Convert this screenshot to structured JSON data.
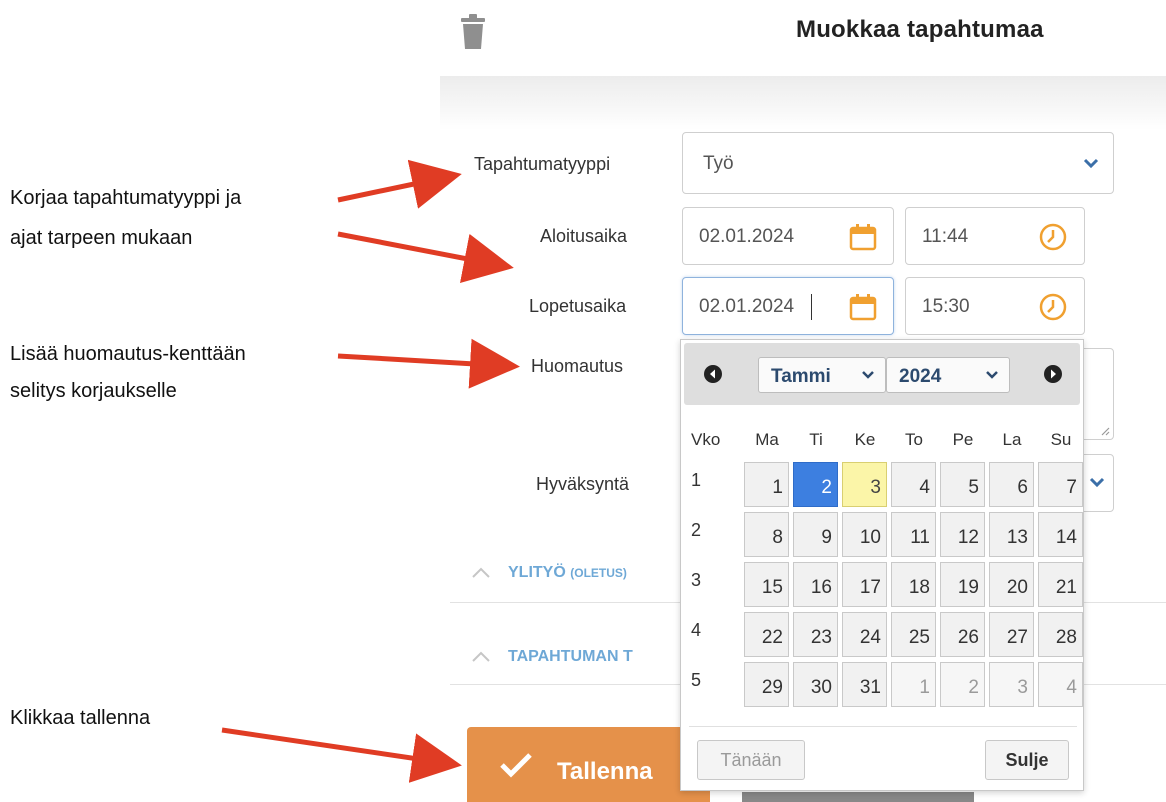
{
  "header": {
    "title": "Muokkaa tapahtumaa"
  },
  "annotations": {
    "event_type_line1": "Korjaa tapahtumatyyppi ja",
    "event_type_line2": "ajat tarpeen mukaan",
    "note_line1": "Lisää huomautus-kenttään",
    "note_line2": "selitys korjaukselle",
    "save": "Klikkaa tallenna"
  },
  "form": {
    "event_type_label": "Tapahtumatyyppi",
    "event_type_value": "Työ",
    "start_label": "Aloitusaika",
    "start_date": "02.01.2024",
    "start_time": "11:44",
    "end_label": "Lopetusaika",
    "end_date": "02.01.2024",
    "end_time": "15:30",
    "note_label": "Huomautus",
    "approval_label": "Hyväksyntä"
  },
  "sections": {
    "overtime": "YLITYÖ",
    "overtime_suffix": "(OLETUS)",
    "event_section": "TAPAHTUMAN T"
  },
  "buttons": {
    "save": "Tallenna"
  },
  "datepicker": {
    "month": "Tammi",
    "year": "2024",
    "week_header": "Vko",
    "weekdays": [
      "Ma",
      "Ti",
      "Ke",
      "To",
      "Pe",
      "La",
      "Su"
    ],
    "weeks": [
      "1",
      "2",
      "3",
      "4",
      "5"
    ],
    "days": [
      [
        "1",
        "2",
        "3",
        "4",
        "5",
        "6",
        "7"
      ],
      [
        "8",
        "9",
        "10",
        "11",
        "12",
        "13",
        "14"
      ],
      [
        "15",
        "16",
        "17",
        "18",
        "19",
        "20",
        "21"
      ],
      [
        "22",
        "23",
        "24",
        "25",
        "26",
        "27",
        "28"
      ],
      [
        "29",
        "30",
        "31",
        "1",
        "2",
        "3",
        "4"
      ]
    ],
    "today_button": "Tänään",
    "close_button": "Sulje"
  },
  "colors": {
    "accent_orange": "#e5914a",
    "arrow_red": "#e03c24",
    "selected_day": "#3d7fe0",
    "today_day": "#fbf5a8",
    "section_blue": "#6ea8d6"
  }
}
